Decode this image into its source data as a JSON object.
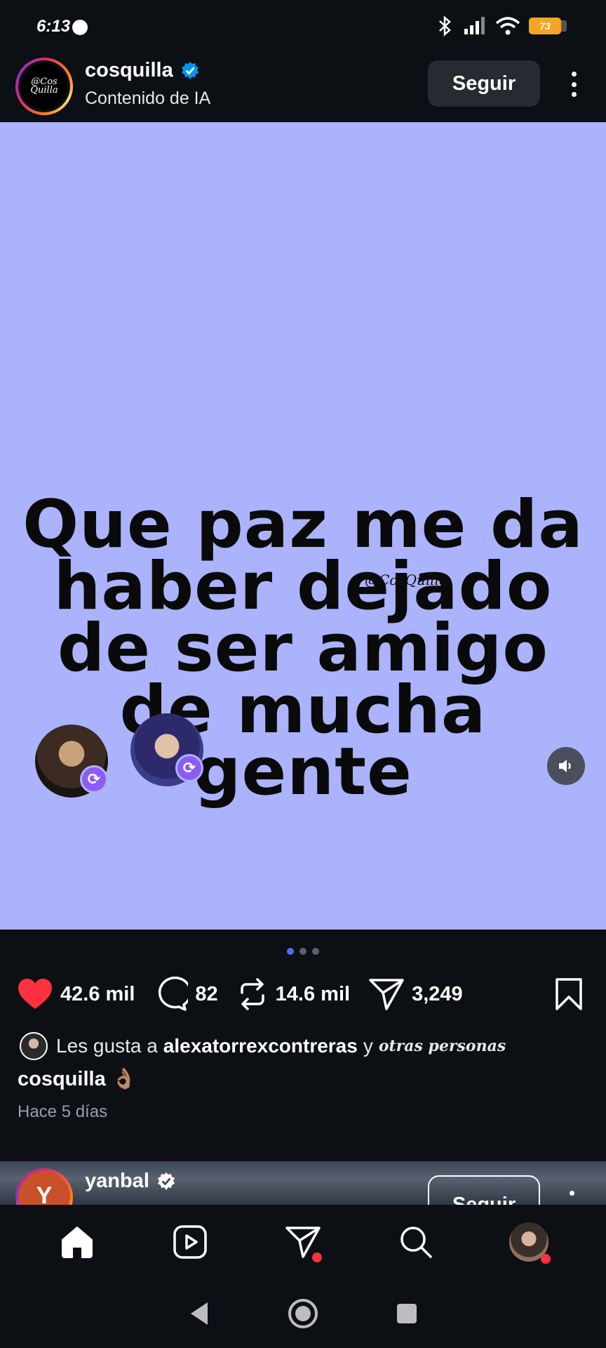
{
  "status_bar": {
    "time": "6:13",
    "battery": "73"
  },
  "post": {
    "username": "cosquilla",
    "subtitle": "Contenido de IA",
    "follow_label": "Seguir",
    "avatar_text": "@Cos Quilla",
    "image_text": "Que paz me da haber dejado de ser amigo de mucha gente",
    "watermark": "@CosQuilla",
    "likes": "42.6 mil",
    "comments": "82",
    "reposts": "14.6 mil",
    "shares": "3,249",
    "liked_by_prefix": "Les gusta a",
    "liked_by_user": "alexatorrexcontreras",
    "liked_by_join": "y",
    "liked_by_others": "otras personas",
    "caption_user": "cosquilla",
    "caption_emoji": "👌🏽",
    "time_ago": "Hace 5 días",
    "carousel_total": 3,
    "carousel_active": 1,
    "liked": true
  },
  "next_post": {
    "username": "yanbal",
    "avatar_letter": "Y",
    "follow_label": "Seguir"
  },
  "colors": {
    "image_bg": "#aab3fb",
    "like": "#ff3040",
    "verified": "#0095f6",
    "repost_badge": "#8b5cf6"
  }
}
